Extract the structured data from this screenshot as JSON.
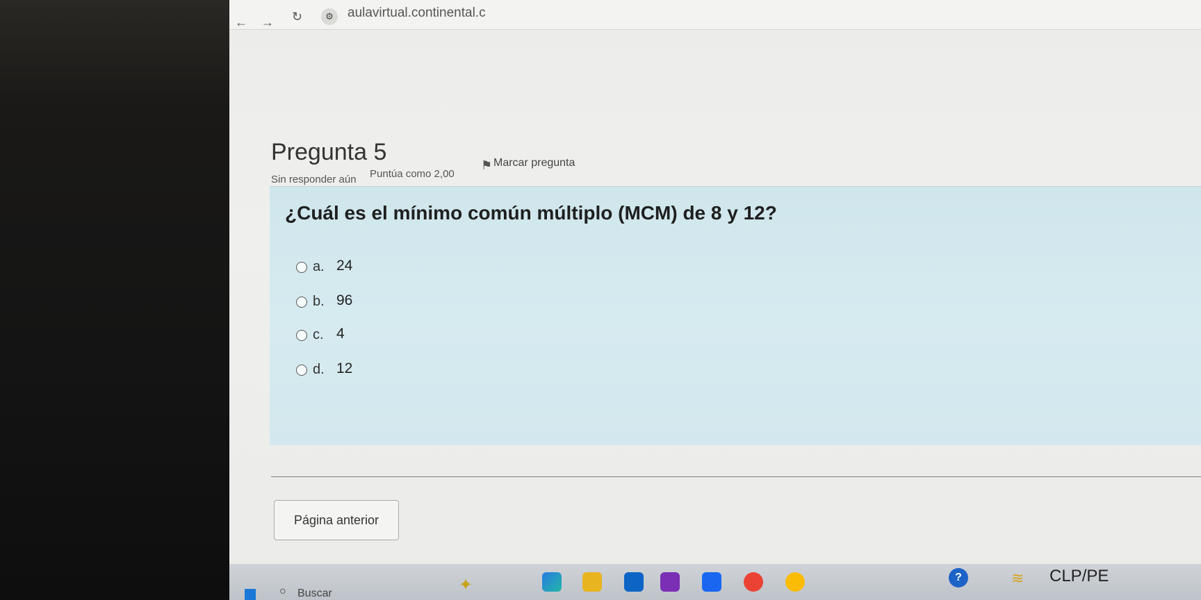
{
  "browser": {
    "url": "aulavirtual.continental.c"
  },
  "question": {
    "number_label": "Pregunta 5",
    "status": "Sin responder aún",
    "score": "Puntúa como 2,00",
    "flag_label": "Marcar pregunta",
    "text": "¿Cuál es el mínimo común múltiplo (MCM) de 8 y 12?",
    "options": [
      {
        "letter": "a.",
        "value": "24"
      },
      {
        "letter": "b.",
        "value": "96"
      },
      {
        "letter": "c.",
        "value": "4"
      },
      {
        "letter": "d.",
        "value": "12"
      }
    ]
  },
  "navigation": {
    "previous_label": "Página anterior"
  },
  "taskbar": {
    "search_label": "Buscar",
    "currency": "CLP/PE"
  },
  "colors": {
    "question_box": "#d3e8ee",
    "screen_bg": "#ececea"
  }
}
